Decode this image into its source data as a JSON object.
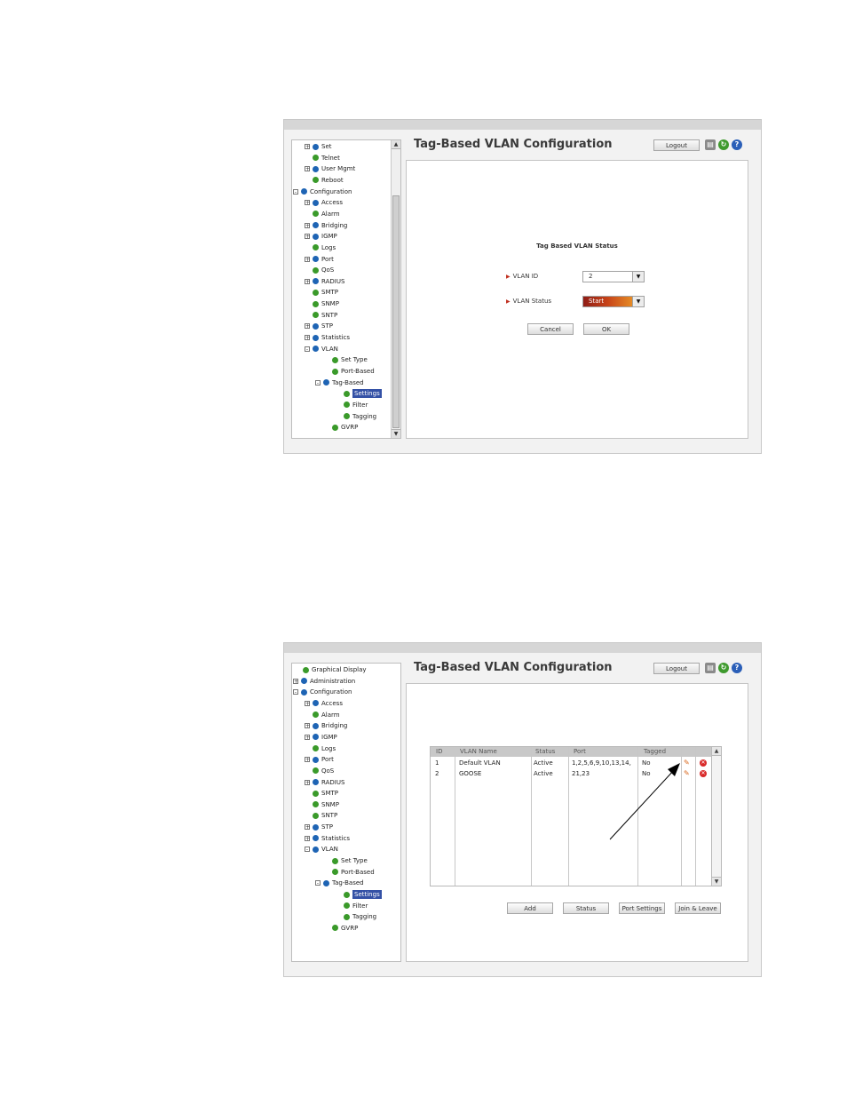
{
  "colors": {
    "accent": "#3451a6",
    "status_gradient_start": "#8f1d16",
    "status_gradient_end": "#f3ac2c"
  },
  "screen1": {
    "title": "Tag-Based VLAN Configuration",
    "logout": "Logout",
    "header_icons": [
      "print-icon",
      "refresh-icon",
      "help-icon"
    ],
    "tree": [
      {
        "label": "Set",
        "toggle": "+",
        "bullet": "blue"
      },
      {
        "label": "Telnet",
        "toggle": "",
        "bullet": "green"
      },
      {
        "label": "User Mgmt",
        "toggle": "+",
        "bullet": "blue"
      },
      {
        "label": "Reboot",
        "toggle": "",
        "bullet": "green"
      },
      {
        "label": "Configuration",
        "toggle": "-",
        "bullet": "blue"
      },
      {
        "label": "Access",
        "toggle": "+",
        "bullet": "blue"
      },
      {
        "label": "Alarm",
        "toggle": "",
        "bullet": "green"
      },
      {
        "label": "Bridging",
        "toggle": "+",
        "bullet": "blue"
      },
      {
        "label": "IGMP",
        "toggle": "+",
        "bullet": "blue"
      },
      {
        "label": "Logs",
        "toggle": "",
        "bullet": "green"
      },
      {
        "label": "Port",
        "toggle": "+",
        "bullet": "blue"
      },
      {
        "label": "QoS",
        "toggle": "",
        "bullet": "green"
      },
      {
        "label": "RADIUS",
        "toggle": "+",
        "bullet": "blue"
      },
      {
        "label": "SMTP",
        "toggle": "",
        "bullet": "green"
      },
      {
        "label": "SNMP",
        "toggle": "",
        "bullet": "green"
      },
      {
        "label": "SNTP",
        "toggle": "",
        "bullet": "green"
      },
      {
        "label": "STP",
        "toggle": "+",
        "bullet": "blue"
      },
      {
        "label": "Statistics",
        "toggle": "+",
        "bullet": "blue"
      },
      {
        "label": "VLAN",
        "toggle": "-",
        "bullet": "blue"
      },
      {
        "label": "Set Type",
        "toggle": "",
        "bullet": "green"
      },
      {
        "label": "Port-Based",
        "toggle": "",
        "bullet": "green"
      },
      {
        "label": "Tag-Based",
        "toggle": "-",
        "bullet": "blue"
      },
      {
        "label": "Settings",
        "toggle": "",
        "bullet": "green",
        "selected": true
      },
      {
        "label": "Filter",
        "toggle": "",
        "bullet": "green"
      },
      {
        "label": "Tagging",
        "toggle": "",
        "bullet": "green"
      },
      {
        "label": "GVRP",
        "toggle": "",
        "bullet": "green"
      }
    ],
    "form": {
      "title": "Tag Based VLAN Status",
      "vlan_id_label": "VLAN ID",
      "vlan_id_value": "2",
      "vlan_status_label": "VLAN Status",
      "vlan_status_value": "Start",
      "cancel": "Cancel",
      "ok": "OK"
    }
  },
  "screen2": {
    "title": "Tag-Based VLAN Configuration",
    "logout": "Logout",
    "tree": [
      {
        "label": "Graphical Display",
        "toggle": "",
        "bullet": "green"
      },
      {
        "label": "Administration",
        "toggle": "+",
        "bullet": "blue"
      },
      {
        "label": "Configuration",
        "toggle": "-",
        "bullet": "blue"
      },
      {
        "label": "Access",
        "toggle": "+",
        "bullet": "blue"
      },
      {
        "label": "Alarm",
        "toggle": "",
        "bullet": "green"
      },
      {
        "label": "Bridging",
        "toggle": "+",
        "bullet": "blue"
      },
      {
        "label": "IGMP",
        "toggle": "+",
        "bullet": "blue"
      },
      {
        "label": "Logs",
        "toggle": "",
        "bullet": "green"
      },
      {
        "label": "Port",
        "toggle": "+",
        "bullet": "blue"
      },
      {
        "label": "QoS",
        "toggle": "",
        "bullet": "green"
      },
      {
        "label": "RADIUS",
        "toggle": "+",
        "bullet": "blue"
      },
      {
        "label": "SMTP",
        "toggle": "",
        "bullet": "green"
      },
      {
        "label": "SNMP",
        "toggle": "",
        "bullet": "green"
      },
      {
        "label": "SNTP",
        "toggle": "",
        "bullet": "green"
      },
      {
        "label": "STP",
        "toggle": "+",
        "bullet": "blue"
      },
      {
        "label": "Statistics",
        "toggle": "+",
        "bullet": "blue"
      },
      {
        "label": "VLAN",
        "toggle": "-",
        "bullet": "blue"
      },
      {
        "label": "Set Type",
        "toggle": "",
        "bullet": "green"
      },
      {
        "label": "Port-Based",
        "toggle": "",
        "bullet": "green"
      },
      {
        "label": "Tag-Based",
        "toggle": "-",
        "bullet": "blue"
      },
      {
        "label": "Settings",
        "toggle": "",
        "bullet": "green",
        "selected": true
      },
      {
        "label": "Filter",
        "toggle": "",
        "bullet": "green"
      },
      {
        "label": "Tagging",
        "toggle": "",
        "bullet": "green"
      },
      {
        "label": "GVRP",
        "toggle": "",
        "bullet": "green"
      }
    ],
    "table": {
      "headers": [
        "ID",
        "VLAN Name",
        "Status",
        "Port",
        "Tagged"
      ],
      "rows": [
        [
          "1",
          "Default VLAN",
          "Active",
          "1,2,5,6,9,10,13,14,",
          "No"
        ],
        [
          "2",
          "GOOSE",
          "Active",
          "21,23",
          "No"
        ]
      ]
    },
    "buttons": {
      "add": "Add",
      "status": "Status",
      "port_settings": "Port Settings",
      "join_leave": "Join & Leave"
    }
  }
}
